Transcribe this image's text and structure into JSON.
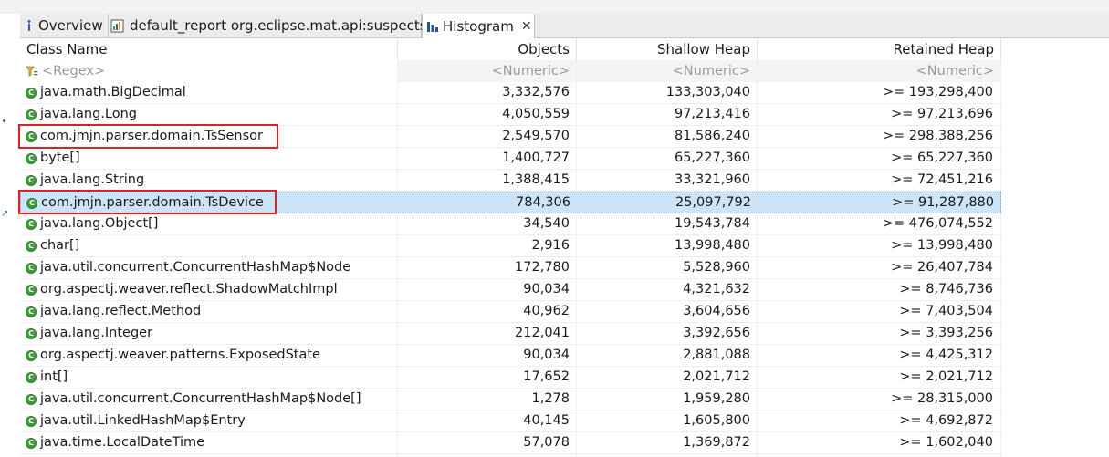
{
  "tabs": [
    {
      "label": "Overview",
      "icon": "info-icon"
    },
    {
      "label": "default_report org.eclipse.mat.api:suspects",
      "icon": "report-icon"
    },
    {
      "label": "Histogram",
      "icon": "histogram-icon",
      "active": true
    }
  ],
  "columns": {
    "name": "Class Name",
    "objects": "Objects",
    "shallow": "Shallow Heap",
    "retained": "Retained Heap"
  },
  "filters": {
    "name": "<Regex>",
    "objects": "<Numeric>",
    "shallow": "<Numeric>",
    "retained": "<Numeric>"
  },
  "rows": [
    {
      "name": "java.math.BigDecimal",
      "objects": "3,332,576",
      "shallow": "133,303,040",
      "retained": ">= 193,298,400"
    },
    {
      "name": "java.lang.Long",
      "objects": "4,050,559",
      "shallow": "97,213,416",
      "retained": ">= 97,213,696"
    },
    {
      "name": "com.jmjn.parser.domain.TsSensor",
      "objects": "2,549,570",
      "shallow": "81,586,240",
      "retained": ">= 298,388,256",
      "highlight": true
    },
    {
      "name": "byte[]",
      "objects": "1,400,727",
      "shallow": "65,227,360",
      "retained": ">= 65,227,360"
    },
    {
      "name": "java.lang.String",
      "objects": "1,388,415",
      "shallow": "33,321,960",
      "retained": ">= 72,451,216"
    },
    {
      "name": "com.jmjn.parser.domain.TsDevice",
      "objects": "784,306",
      "shallow": "25,097,792",
      "retained": ">= 91,287,880",
      "highlight": true,
      "selected": true
    },
    {
      "name": "java.lang.Object[]",
      "objects": "34,540",
      "shallow": "19,543,784",
      "retained": ">= 476,074,552"
    },
    {
      "name": "char[]",
      "objects": "2,916",
      "shallow": "13,998,480",
      "retained": ">= 13,998,480"
    },
    {
      "name": "java.util.concurrent.ConcurrentHashMap$Node",
      "objects": "172,780",
      "shallow": "5,528,960",
      "retained": ">= 26,407,784"
    },
    {
      "name": "org.aspectj.weaver.reflect.ShadowMatchImpl",
      "objects": "90,034",
      "shallow": "4,321,632",
      "retained": ">= 8,746,736"
    },
    {
      "name": "java.lang.reflect.Method",
      "objects": "40,962",
      "shallow": "3,604,656",
      "retained": ">= 7,403,504"
    },
    {
      "name": "java.lang.Integer",
      "objects": "212,041",
      "shallow": "3,392,656",
      "retained": ">= 3,393,256"
    },
    {
      "name": "org.aspectj.weaver.patterns.ExposedState",
      "objects": "90,034",
      "shallow": "2,881,088",
      "retained": ">= 4,425,312"
    },
    {
      "name": "int[]",
      "objects": "17,652",
      "shallow": "2,021,712",
      "retained": ">= 2,021,712"
    },
    {
      "name": "java.util.concurrent.ConcurrentHashMap$Node[]",
      "objects": "1,278",
      "shallow": "1,959,280",
      "retained": ">= 28,315,000"
    },
    {
      "name": "java.util.LinkedHashMap$Entry",
      "objects": "40,145",
      "shallow": "1,605,800",
      "retained": ">= 4,692,872"
    },
    {
      "name": "java.time.LocalDateTime",
      "objects": "57,078",
      "shallow": "1,369,872",
      "retained": ">= 1,602,040"
    }
  ],
  "colors": {
    "selection": "#cce4f7",
    "highlight_box": "#e02020",
    "class_icon": "#3a9c3a"
  }
}
